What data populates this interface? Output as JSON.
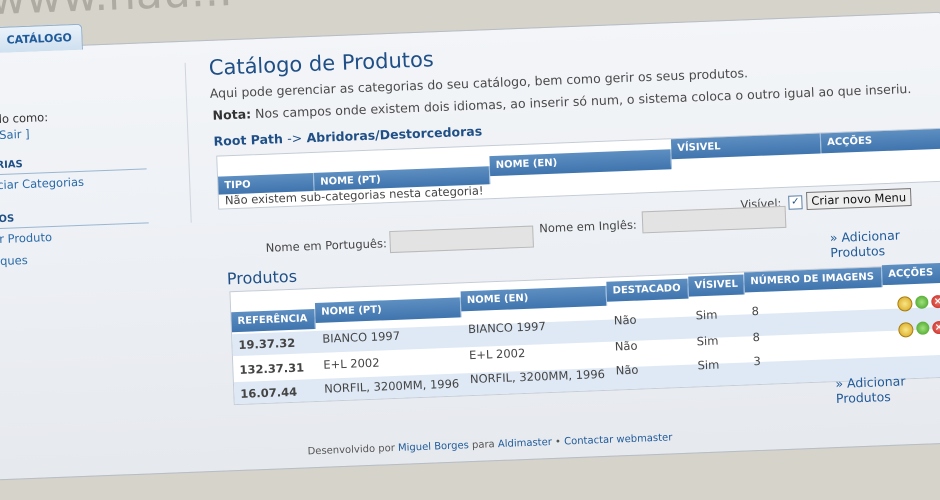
{
  "tab": {
    "label": "CATÁLOGO"
  },
  "logo": {
    "text": "www.nau..."
  },
  "sidebar": {
    "logged_as": "do como:",
    "logout": "Sair ]",
    "section1": "RIAS",
    "link1": "ciar Categorias",
    "section2": "OS",
    "link2": "r Produto",
    "link3": "ques"
  },
  "main": {
    "title": "Catálogo de Produtos",
    "description": "Aqui pode gerenciar as categorias do seu catálogo, bem como gerir os seus produtos.",
    "note_label": "Nota:",
    "note_text": "Nos campos onde existem dois idiomas, ao inserir só num, o sistema coloca o outro igual ao que inseriu.",
    "root_path_label": "Root Path",
    "root_path_sep": "->",
    "root_path_value": "Abridoras/Destorcedoras"
  },
  "categories_table": {
    "headers": [
      "TIPO",
      "NOME (PT)",
      "NOME (EN)",
      "VÍSIVEL",
      "ACÇÕES"
    ],
    "empty_message": "Não existem sub-categorias nesta categoria!"
  },
  "category_form": {
    "name_pt_label": "Nome em Português:",
    "name_en_label": "Nome em Inglês:",
    "visible_label": "Visível:",
    "visible_checked": true,
    "submit_label": "Criar novo Menu"
  },
  "products": {
    "title": "Produtos",
    "add_link": "» Adicionar Produtos",
    "headers": [
      "REFERÊNCIA",
      "NOME (PT)",
      "NOME (EN)",
      "DESTACADO",
      "VÍSIVEL",
      "NÚMERO DE IMAGENS",
      "ACÇÕES"
    ],
    "rows": [
      {
        "ref": "19.37.32",
        "name_pt": "BIANCO 1997",
        "name_en": "BIANCO 1997",
        "featured": "Não",
        "visible": "Sim",
        "images": "8"
      },
      {
        "ref": "132.37.31",
        "name_pt": "E+L 2002",
        "name_en": "E+L 2002",
        "featured": "Não",
        "visible": "Sim",
        "images": "8"
      },
      {
        "ref": "16.07.44",
        "name_pt": "NORFIL, 3200MM, 1996",
        "name_en": "NORFIL, 3200MM, 1996",
        "featured": "Não",
        "visible": "Sim",
        "images": "3"
      }
    ]
  },
  "footer": {
    "text": "Desenvolvido por",
    "author": "Miguel Borges",
    "for_text": "para",
    "client": "Aldimaster",
    "sep": "•",
    "contact": "Contactar webmaster"
  },
  "icons": {
    "view": "view-icon",
    "edit": "gear-edit-icon",
    "delete": "delete-icon"
  },
  "colors": {
    "header_blue": "#3f74ad",
    "title_blue": "#1f4f86",
    "row_alt": "#dfe9f5"
  }
}
